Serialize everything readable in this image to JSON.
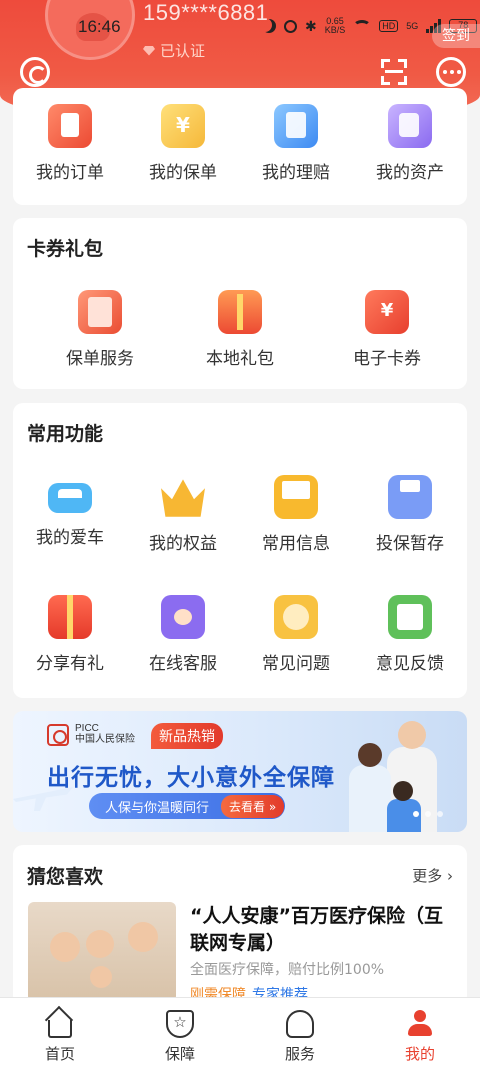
{
  "status_bar": {
    "time": "16:46",
    "speed": "0.65",
    "speed_unit": "KB/S",
    "hd": "HD",
    "battery": "78",
    "network": "5G"
  },
  "header": {
    "phone": "159****6881",
    "verified": "已认证",
    "checkin": "签到"
  },
  "quick_menu": [
    {
      "label": "我的订单",
      "icon": "order-icon"
    },
    {
      "label": "我的保单",
      "icon": "policy-icon"
    },
    {
      "label": "我的理赔",
      "icon": "claim-icon"
    },
    {
      "label": "我的资产",
      "icon": "asset-icon"
    }
  ],
  "coupons": {
    "title": "卡券礼包",
    "items": [
      {
        "label": "保单服务",
        "icon": "policy-service-icon"
      },
      {
        "label": "本地礼包",
        "icon": "gift-box-icon"
      },
      {
        "label": "电子卡券",
        "icon": "ticket-icon"
      }
    ]
  },
  "functions": {
    "title": "常用功能",
    "items": [
      {
        "label": "我的爱车",
        "icon": "car-icon"
      },
      {
        "label": "我的权益",
        "icon": "crown-icon"
      },
      {
        "label": "常用信息",
        "icon": "folder-icon"
      },
      {
        "label": "投保暂存",
        "icon": "save-icon"
      },
      {
        "label": "分享有礼",
        "icon": "share-gift-icon"
      },
      {
        "label": "在线客服",
        "icon": "customer-service-icon"
      },
      {
        "label": "常见问题",
        "icon": "faq-icon"
      },
      {
        "label": "意见反馈",
        "icon": "feedback-icon"
      }
    ]
  },
  "banner": {
    "picc": "PICC",
    "company": "中国人民保险",
    "badge": "新品热销",
    "headline": "出行无忧，大小意外全保障",
    "slogan": "人保与你温暖同行",
    "button": "去看看 »"
  },
  "recommend": {
    "title": "猜您喜欢",
    "more": "更多",
    "product": {
      "title": "“人人安康”百万医疗保险（互联网专属）",
      "desc": "全面医疗保障，赔付比例100%",
      "tags": [
        "刚需保障",
        "专家推荐"
      ]
    }
  },
  "nav": [
    {
      "label": "首页",
      "icon": "home-icon"
    },
    {
      "label": "保障",
      "icon": "shield-icon"
    },
    {
      "label": "服务",
      "icon": "service-icon"
    },
    {
      "label": "我的",
      "icon": "profile-icon",
      "active": true
    }
  ],
  "colors": {
    "brand_red": "#e8412f",
    "headline_blue": "#1f58c8",
    "tag_orange": "#f08a2a",
    "tag_blue": "#2f78e6"
  }
}
